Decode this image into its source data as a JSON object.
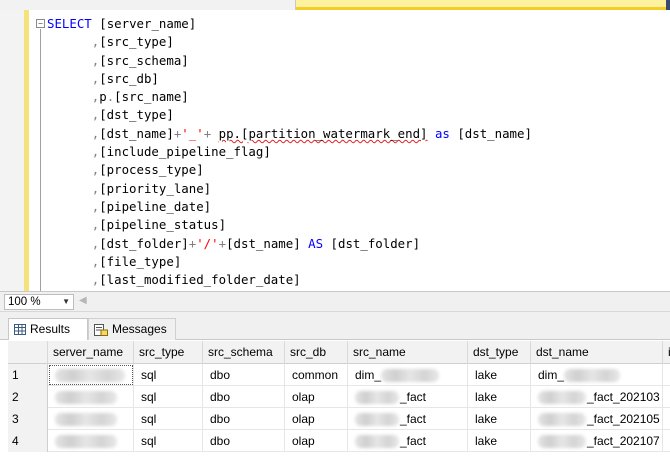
{
  "editor": {
    "lines": [
      [
        {
          "t": "SELECT",
          "c": "kw"
        },
        {
          "t": " ",
          "c": ""
        },
        {
          "t": "[server_name]",
          "c": "br"
        }
      ],
      [
        {
          "t": "      ,",
          "c": "op"
        },
        {
          "t": "[src_type]",
          "c": "br"
        }
      ],
      [
        {
          "t": "      ,",
          "c": "op"
        },
        {
          "t": "[src_schema]",
          "c": "br"
        }
      ],
      [
        {
          "t": "      ,",
          "c": "op"
        },
        {
          "t": "[src_db]",
          "c": "br"
        }
      ],
      [
        {
          "t": "      ,",
          "c": "op"
        },
        {
          "t": "p",
          "c": "br"
        },
        {
          "t": ".",
          "c": "op"
        },
        {
          "t": "[src_name]",
          "c": "br"
        }
      ],
      [
        {
          "t": "      ,",
          "c": "op"
        },
        {
          "t": "[dst_type]",
          "c": "br"
        }
      ],
      [
        {
          "t": "      ,",
          "c": "op"
        },
        {
          "t": "[dst_name]",
          "c": "br"
        },
        {
          "t": "+",
          "c": "op"
        },
        {
          "t": "'_'",
          "c": "str"
        },
        {
          "t": "+ ",
          "c": "op"
        },
        {
          "t": "pp.[partition_watermark_end]",
          "c": "br squig"
        },
        {
          "t": " ",
          "c": ""
        },
        {
          "t": "as",
          "c": "kw"
        },
        {
          "t": " [dst_name]",
          "c": "br"
        }
      ],
      [
        {
          "t": "      ,",
          "c": "op"
        },
        {
          "t": "[include_pipeline_flag]",
          "c": "br"
        }
      ],
      [
        {
          "t": "      ,",
          "c": "op"
        },
        {
          "t": "[process_type]",
          "c": "br"
        }
      ],
      [
        {
          "t": "      ,",
          "c": "op"
        },
        {
          "t": "[priority_lane]",
          "c": "br"
        }
      ],
      [
        {
          "t": "      ,",
          "c": "op"
        },
        {
          "t": "[pipeline_date]",
          "c": "br"
        }
      ],
      [
        {
          "t": "      ,",
          "c": "op"
        },
        {
          "t": "[pipeline_status]",
          "c": "br"
        }
      ],
      [
        {
          "t": "      ,",
          "c": "op"
        },
        {
          "t": "[dst_folder]",
          "c": "br"
        },
        {
          "t": "+",
          "c": "op"
        },
        {
          "t": "'/'",
          "c": "str"
        },
        {
          "t": "+",
          "c": "op"
        },
        {
          "t": "[dst_name]",
          "c": "br"
        },
        {
          "t": " ",
          "c": ""
        },
        {
          "t": "AS",
          "c": "kw"
        },
        {
          "t": " [dst_folder]",
          "c": "br"
        }
      ],
      [
        {
          "t": "      ,",
          "c": "op"
        },
        {
          "t": "[file_type]",
          "c": "br"
        }
      ],
      [
        {
          "t": "      ,",
          "c": "op"
        },
        {
          "t": "[last_modified_folder_date]",
          "c": "br"
        }
      ]
    ]
  },
  "zoom": {
    "value": "100 %"
  },
  "results_tabs": {
    "results": "Results",
    "messages": "Messages"
  },
  "grid": {
    "columns": [
      "server_name",
      "src_type",
      "src_schema",
      "src_db",
      "src_name",
      "dst_type",
      "dst_name",
      "i"
    ],
    "rows": [
      {
        "n": "1",
        "server_name": "",
        "src_type": "sql",
        "src_schema": "dbo",
        "src_db": "common",
        "src_name": "dim_",
        "dst_type": "lake",
        "dst_name": "dim_"
      },
      {
        "n": "2",
        "server_name": "",
        "src_type": "sql",
        "src_schema": "dbo",
        "src_db": "olap",
        "src_name": "_fact",
        "dst_type": "lake",
        "dst_name": "_fact_202103"
      },
      {
        "n": "3",
        "server_name": "",
        "src_type": "sql",
        "src_schema": "dbo",
        "src_db": "olap",
        "src_name": "_fact",
        "dst_type": "lake",
        "dst_name": "_fact_202105"
      },
      {
        "n": "4",
        "server_name": "",
        "src_type": "sql",
        "src_schema": "dbo",
        "src_db": "olap",
        "src_name": "_fact",
        "dst_type": "lake",
        "dst_name": "_fact_202107"
      }
    ]
  }
}
